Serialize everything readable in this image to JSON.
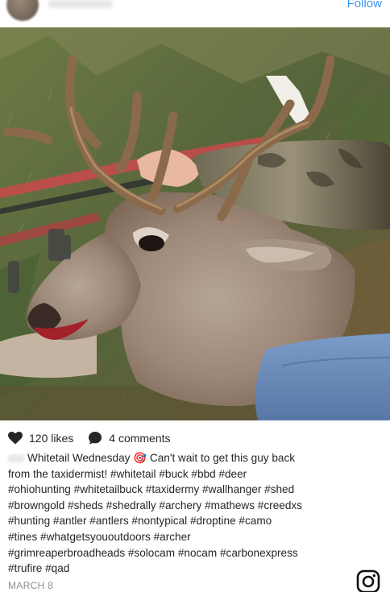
{
  "header": {
    "follow_label": "Follow"
  },
  "post": {
    "likes": "120 likes",
    "comments": "4 comments",
    "caption_lines": [
      "Whitetail Wednesday 🎯 Can't wait to get this guy back",
      "from the taxidermist! #whitetail #buck #bbd #deer",
      "#ohiohunting #whitetailbuck #taxidermy #wallhanger #shed",
      "#browngold #sheds #shedrally #archery #mathews #creedxs",
      "#hunting #antler #antlers #nontypical #droptine #camo",
      "#tines #whatgetsyououtdoors #archer",
      "#grimreaperbroadheads #solocam #nocam #carbonexpress",
      "#trufire #qad"
    ],
    "date": "MARCH 8"
  },
  "icons": {
    "like": "heart-icon",
    "comment": "comment-bubble-icon",
    "brand": "instagram-logo-icon"
  },
  "colors": {
    "link": "#3897f0",
    "text": "#262626",
    "muted": "#8e8e8e"
  }
}
